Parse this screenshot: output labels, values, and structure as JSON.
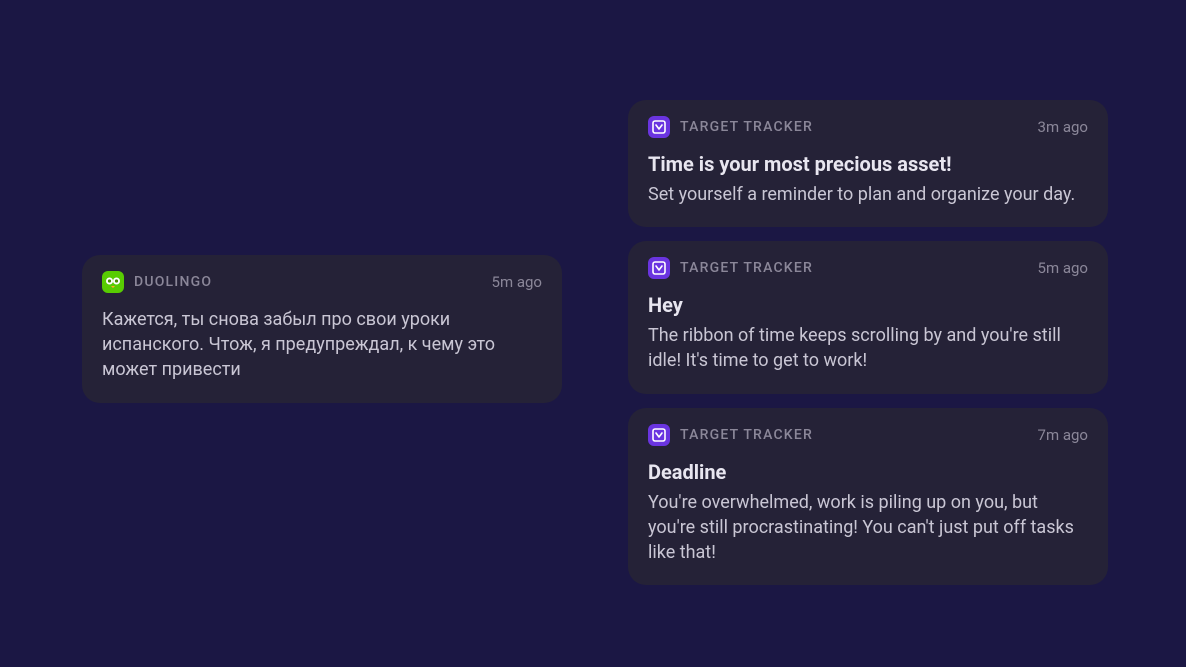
{
  "left": {
    "app": "DUOLINGO",
    "time": "5m ago",
    "body": "Кажется, ты снова забыл про свои уроки испанского. Чтож, я предупреждал, к чему это может привести"
  },
  "right": [
    {
      "app": "TARGET TRACKER",
      "time": "3m ago",
      "title": "Time is your most precious asset!",
      "body": "Set yourself a reminder to plan and organize your day."
    },
    {
      "app": "TARGET TRACKER",
      "time": "5m ago",
      "title": "Hey",
      "body": "The ribbon of time keeps scrolling by and you're still idle! It's time to get to work!"
    },
    {
      "app": "TARGET TRACKER",
      "time": "7m ago",
      "title": "Deadline",
      "body": "You're overwhelmed, work is piling up on you, but you're still procrastinating! You can't just put off tasks like that!"
    }
  ]
}
